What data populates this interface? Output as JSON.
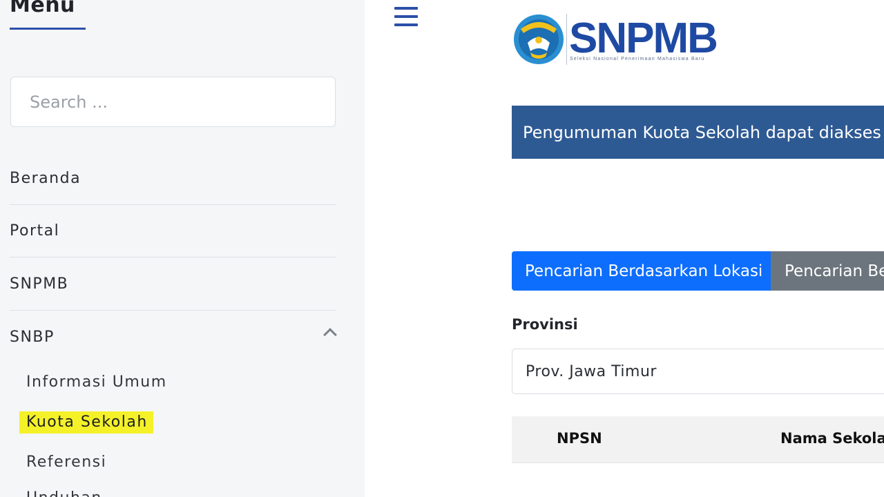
{
  "sidebar": {
    "title": "Menu",
    "search_placeholder": "Search ...",
    "items": [
      {
        "label": "Beranda"
      },
      {
        "label": "Portal"
      },
      {
        "label": "SNPMB"
      },
      {
        "label": "SNBP",
        "expanded": true
      }
    ],
    "sub_items": [
      {
        "label": "Informasi Umum"
      },
      {
        "label": "Kuota Sekolah",
        "highlighted": true
      },
      {
        "label": "Referensi"
      },
      {
        "label": "Unduhan"
      }
    ]
  },
  "header": {
    "menu_icon": "hamburger-icon",
    "logo_text": "SNPMB",
    "logo_subtitle": "Seleksi Nasional Penerimaan Mahasiswa Baru"
  },
  "main": {
    "banner_text": "Pengumuman Kuota Sekolah dapat diakses",
    "tabs": [
      {
        "label": "Pencarian Berdasarkan Lokasi",
        "active": true
      },
      {
        "label": "Pencarian Be",
        "active": false
      }
    ],
    "province_label": "Provinsi",
    "province_value": "Prov. Jawa Timur",
    "table_headers": [
      "NPSN",
      "Nama Sekolah"
    ]
  },
  "colors": {
    "accent_blue": "#2c4fa8",
    "banner_blue": "#2e5a94",
    "tab_active": "#0d6efd",
    "tab_inactive": "#6c757d",
    "highlight_yellow": "#f5f129"
  }
}
